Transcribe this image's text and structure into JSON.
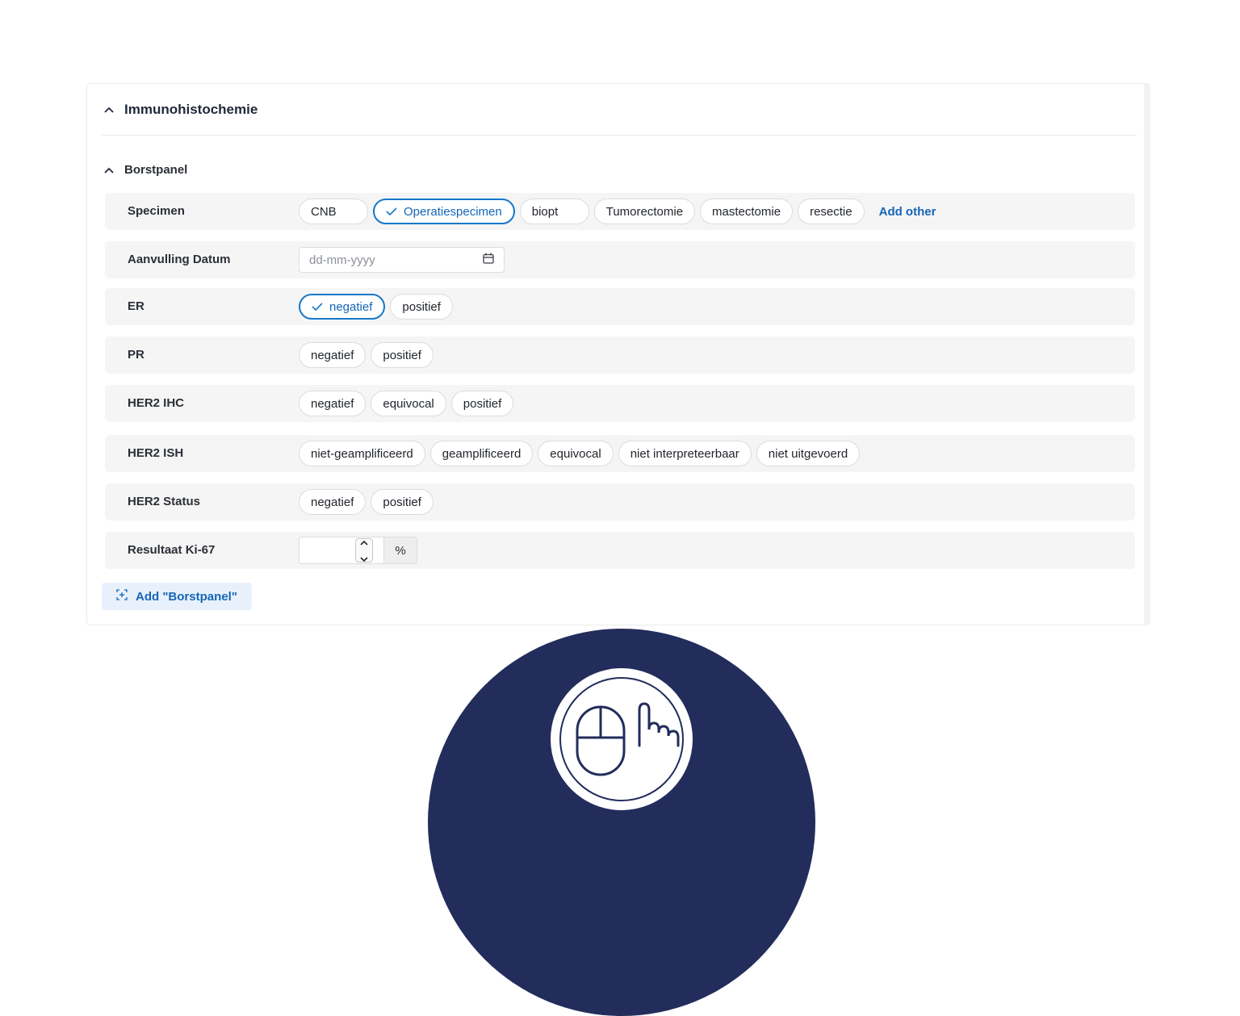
{
  "section": {
    "title": "Immunohistochemie"
  },
  "subsection": {
    "title": "Borstpanel"
  },
  "rows": {
    "specimen": {
      "label": "Specimen",
      "options": [
        "CNB",
        "Operatiespecimen",
        "biopt",
        "Tumorectomie",
        "mastectomie",
        "resectie"
      ],
      "selected": "Operatiespecimen",
      "add_other": "Add other"
    },
    "aanvulling": {
      "label": "Aanvulling Datum",
      "placeholder": "dd-mm-yyyy"
    },
    "er": {
      "label": "ER",
      "options": [
        "negatief",
        "positief"
      ],
      "selected": "negatief"
    },
    "pr": {
      "label": "PR",
      "options": [
        "negatief",
        "positief"
      ]
    },
    "her2_ihc": {
      "label": "HER2 IHC",
      "options": [
        "negatief",
        "equivocal",
        "positief"
      ]
    },
    "her2_ish": {
      "label": "HER2 ISH",
      "options": [
        "niet-geamplificeerd",
        "geamplificeerd",
        "equivocal",
        "niet interpreteerbaar",
        "niet uitgevoerd"
      ]
    },
    "her2_status": {
      "label": "HER2 Status",
      "options": [
        "negatief",
        "positief"
      ]
    },
    "ki67": {
      "label": "Resultaat Ki-67",
      "value": "",
      "unit": "%"
    }
  },
  "add_button": {
    "label": "Add \"Borstpanel\""
  },
  "colors": {
    "accent": "#1677c9",
    "badge_background": "#232d5c"
  },
  "icons": {
    "collapse": "chevron-up-icon",
    "check": "check-icon",
    "calendar": "calendar-icon",
    "add": "add-group-icon",
    "badge": "mouse-pointer-hand-icon"
  }
}
